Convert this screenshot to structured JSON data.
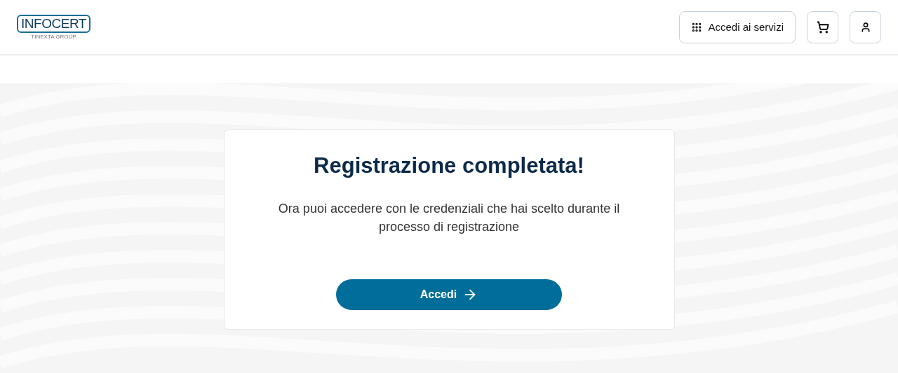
{
  "header": {
    "logo": {
      "name": "INFOCERT",
      "tagline": "TINEXTA GROUP"
    },
    "services_button": "Accedi ai servizi"
  },
  "card": {
    "title": "Registrazione completata!",
    "message": "Ora puoi accedere con le credenziali che hai scelto durante il processo di registrazione",
    "button": "Accedi"
  }
}
